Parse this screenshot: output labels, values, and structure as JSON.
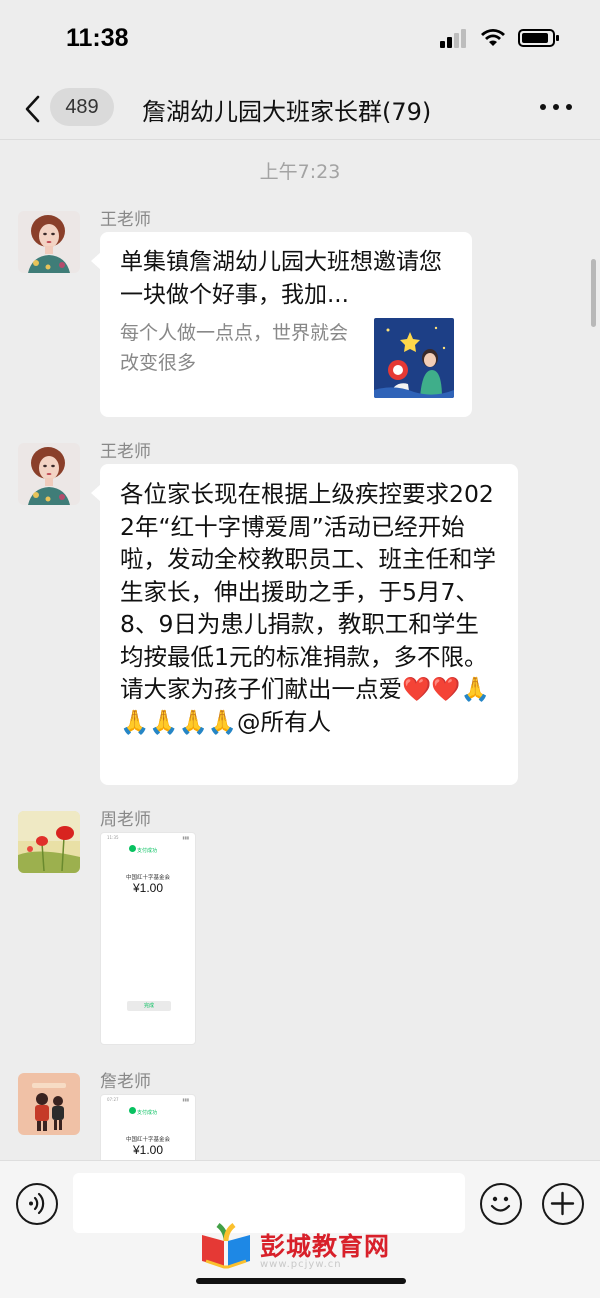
{
  "status_bar": {
    "time": "11:38"
  },
  "nav": {
    "unread_count": "489",
    "title": "詹湖幼儿园大班家长群(79)"
  },
  "chat": {
    "timestamp": "上午7:23",
    "messages": [
      {
        "sender": "王老师",
        "type": "link-card",
        "title": "单集镇詹湖幼儿园大班想邀请您一块做个好事，我加...",
        "description": "每个人做一点点，世界就会改变很多"
      },
      {
        "sender": "王老师",
        "type": "text",
        "text": "各位家长现在根据上级疾控要求2022年“红十字博爱周”活动已经开始啦，发动全校教职员工、班主任和学生家长，伸出援助之手，于5月7、8、9日为患儿捐款，教职工和学生均按最低1元的标准捐款，多不限。请大家为孩子们献出一点爱❤️❤️🙏🙏🙏🙏🙏@所有人"
      },
      {
        "sender": "周老师",
        "type": "image",
        "screenshot": {
          "status_time": "11:35",
          "header": "支付成功",
          "org": "中国红十字基金会",
          "amount": "¥1.00",
          "button": "完成"
        }
      },
      {
        "sender": "詹老师",
        "type": "image",
        "screenshot": {
          "status_time": "07:27",
          "header": "支付成功",
          "org": "中国红十字基金会",
          "amount": "¥1.00"
        }
      }
    ]
  },
  "input_bar": {
    "placeholder": ""
  },
  "watermark": {
    "text": "彭城教育网",
    "url": "www.pcjyw.cn"
  },
  "colors": {
    "bg": "#ededed",
    "bubble": "#ffffff",
    "accent_green": "#07c160",
    "watermark_red": "#d8202a"
  }
}
